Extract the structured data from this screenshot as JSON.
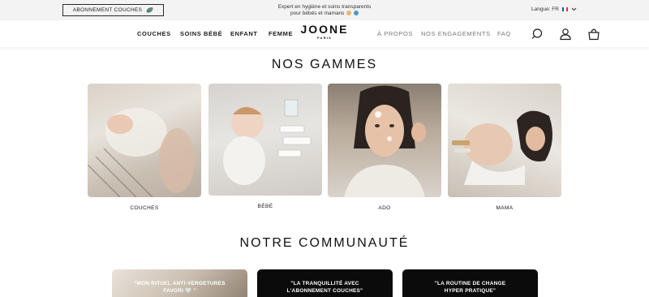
{
  "topbar": {
    "subscription_label": "ABONNEMENT COUCHES",
    "promo_line1": "Expert en hygiène et soins transparents",
    "promo_line2": "pour bébés et mamans",
    "language_label": "Langue: FR",
    "subscription_icon": "leaf-truck-icon",
    "language_chevron_icon": "chevron-down-icon"
  },
  "nav": {
    "left_links": [
      "COUCHES",
      "SOINS BÉBÉ",
      "ENFANT",
      "FEMME"
    ],
    "logo_word": "JOONE",
    "logo_city": "PARIS",
    "right_links": [
      "À PROPOS",
      "NOS ENGAGEMENTS",
      "FAQ"
    ],
    "icons": [
      "search-icon",
      "account-icon",
      "cart-icon"
    ]
  },
  "gammes": {
    "title": "NOS GAMMES",
    "items": [
      {
        "label": "COUCHES"
      },
      {
        "label": "BÉBÉ"
      },
      {
        "label": "ADO"
      },
      {
        "label": "MAMA"
      }
    ]
  },
  "communaute": {
    "title": "NOTRE COMMUNAUTÉ",
    "cards": [
      {
        "line1": "\"MON RITUEL ANTI-VERGETURES",
        "line2": "FAVORI 🤍 \""
      },
      {
        "line1": "\"LA TRANQUILLITÉ AVEC",
        "line2": "L'ABONNEMENT COUCHES\""
      },
      {
        "line1": "\"LA ROUTINE DE CHANGE",
        "line2": "HYPER PRATIQUE\""
      }
    ]
  },
  "colors": {
    "topbar_bg": "#f3f3f3",
    "text": "#1b1b1b",
    "nav_secondary": "#777777",
    "dark_card": "#0b0b0b"
  }
}
